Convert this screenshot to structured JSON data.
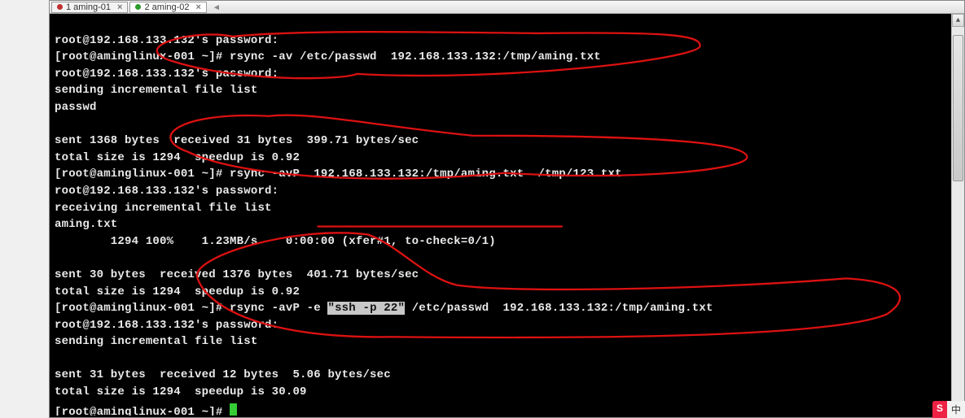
{
  "tabs": [
    {
      "label": "1 aming-01",
      "active": false
    },
    {
      "label": "2 aming-02",
      "active": true
    }
  ],
  "lines": {
    "l0": "root@192.168.133.132's password:",
    "l1": "[root@aminglinux-001 ~]# rsync -av /etc/passwd  192.168.133.132:/tmp/aming.txt",
    "l2": "root@192.168.133.132's password:",
    "l3": "sending incremental file list",
    "l4": "passwd",
    "l5": "",
    "l6": "sent 1368 bytes  received 31 bytes  399.71 bytes/sec",
    "l7": "total size is 1294  speedup is 0.92",
    "l8": "[root@aminglinux-001 ~]# rsync -avP  192.168.133.132:/tmp/aming.txt  /tmp/123.txt",
    "l9": "root@192.168.133.132's password:",
    "l10": "receiving incremental file list",
    "l11": "aming.txt",
    "l12": "        1294 100%    1.23MB/s    0:00:00 (xfer#1, to-check=0/1)",
    "l13": "",
    "l14": "sent 30 bytes  received 1376 bytes  401.71 bytes/sec",
    "l15": "total size is 1294  speedup is 0.92",
    "l16a": "[root@aminglinux-001 ~]# rsync -avP -e ",
    "l16hl": "\"ssh -p 22\"",
    "l16b": " /etc/passwd  192.168.133.132:/tmp/aming.txt",
    "l17": "root@192.168.133.132's password:",
    "l18": "sending incremental file list",
    "l19": "",
    "l20": "sent 31 bytes  received 12 bytes  5.06 bytes/sec",
    "l21": "total size is 1294  speedup is 30.09",
    "l22": "[root@aminglinux-001 ~]# "
  },
  "badge": {
    "logo": "S",
    "text": "中"
  }
}
